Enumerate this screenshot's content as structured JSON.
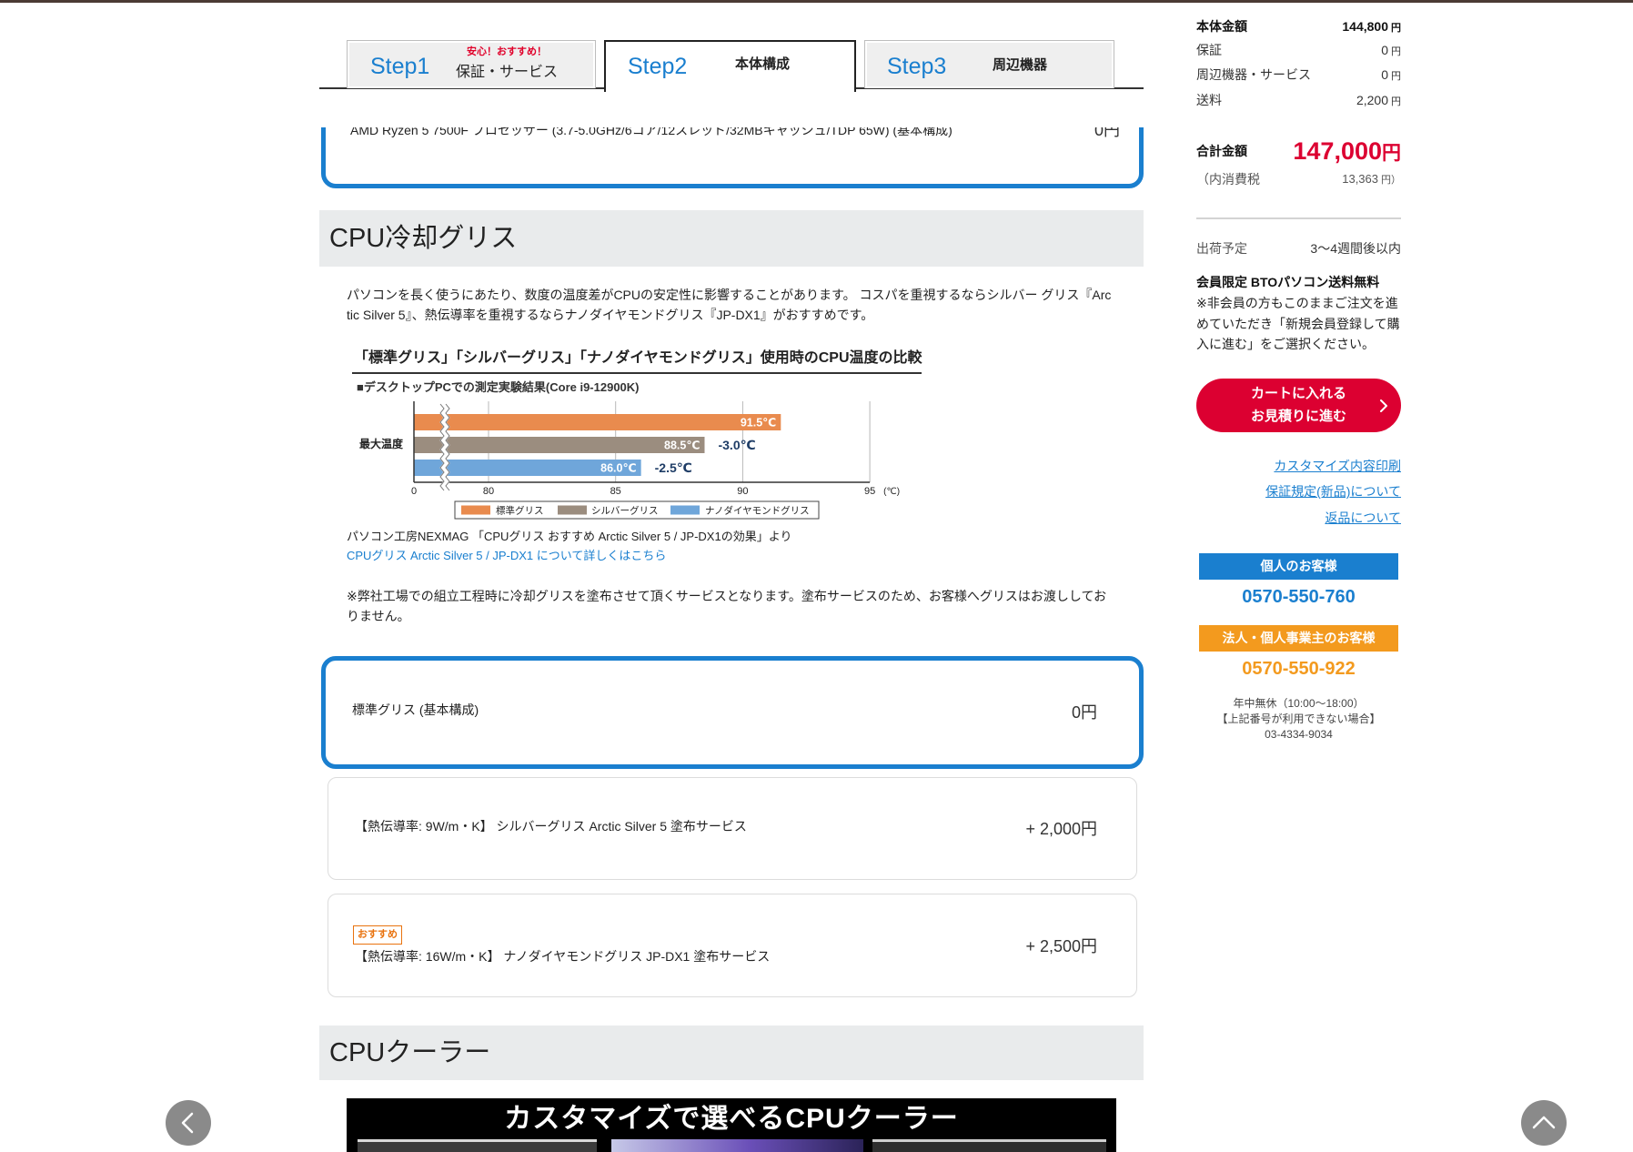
{
  "header": {
    "tabs": [
      {
        "step": "Step1",
        "badge": "安心！おすすめ！",
        "label": "保証・サービス",
        "active": false
      },
      {
        "step": "Step2",
        "label": "本体構成",
        "active": true
      },
      {
        "step": "Step3",
        "label": "周辺機器",
        "active": false
      }
    ]
  },
  "cpu_option": {
    "label": "AMD Ryzen 5 7500F プロセッサー (3.7-5.0GHz/6コア/12スレッド/32MBキャッシュ/TDP 65W) (基本構成)",
    "price": "0円",
    "selected": true
  },
  "grease_section": {
    "title": "CPU冷却グリス",
    "intro_lines": [
      "パソコンを長く使うにあたり、数度の温度差がCPUの安定性に影響することがあります。 コスパを重視するならシルバー グリス『Arc",
      "tic Silver 5』、熱伝導率を重視するならナノダイヤモンドグリス『JP-DX1』がおすすめです。"
    ],
    "source": "パソコン工房NEXMAG 「CPUグリス おすすめ Arctic Silver 5 / JP-DX1の効果」より",
    "link": "CPUグリス Arctic Silver 5 / JP-DX1 について詳しくはこちら",
    "note_lines": [
      "※弊社工場での組立工程時に冷却グリスを塗布させて頂くサービスとなります。塗布サービスのため、お客様へグリスはお渡ししてお",
      "りません。"
    ],
    "options": [
      {
        "label": "標準グリス (基本構成)",
        "price": "0円",
        "selected": true
      },
      {
        "label": "【熱伝導率: 9W/m・K】 シルバーグリス Arctic Silver 5 塗布サービス",
        "price": "+ 2,000円",
        "selected": false
      },
      {
        "badge": "おすすめ",
        "label": "【熱伝導率: 16W/m・K】 ナノダイヤモンドグリス JP-DX1 塗布サービス",
        "price": "+ 2,500円",
        "selected": false
      }
    ]
  },
  "cooler_section": {
    "title": "CPUクーラー",
    "banner_text": "カスタマイズで選べるCPUクーラー"
  },
  "chart_data": {
    "type": "bar",
    "orientation": "horizontal",
    "title": "「標準グリス」「シルバーグリス」「ナノダイヤモンドグリス」使用時のCPU温度の比較",
    "subtitle": "■デスクトップPCでの測定実験結果(Core i9-12900K)",
    "ylabel": "最大温度",
    "x_unit": "(℃)",
    "x_ticks": [
      "0",
      "80",
      "85",
      "90",
      "95"
    ],
    "x_tick_values": [
      0,
      80,
      85,
      90,
      95
    ],
    "xlim": [
      0,
      95
    ],
    "axis_break": [
      0,
      80
    ],
    "grid": true,
    "legend_position": "bottom",
    "series": [
      {
        "name": "標準グリス",
        "value": 91.5,
        "label": "91.5℃",
        "color": "#e98b4e"
      },
      {
        "name": "シルバーグリス",
        "value": 88.5,
        "label": "88.5℃",
        "diff": "-3.0℃",
        "color": "#9b8d7f"
      },
      {
        "name": "ナノダイヤモンドグリス",
        "value": 86.0,
        "label": "86.0℃",
        "diff": "-2.5℃",
        "color": "#6fa6da"
      }
    ]
  },
  "sidebar": {
    "summary": [
      {
        "label": "本体金額",
        "value": "144,800",
        "unit": "円"
      },
      {
        "label": "保証",
        "value": "0",
        "unit": "円"
      },
      {
        "label": "周辺機器・サービス",
        "value": "0",
        "unit": "円"
      },
      {
        "label": "送料",
        "value": "2,200",
        "unit": "円"
      }
    ],
    "total_label": "合計金額",
    "total_value": "147,000",
    "total_unit": "円",
    "tax_label": "（内消費税",
    "tax_value": "13,363",
    "tax_unit": "円）",
    "ship_label": "出荷予定",
    "ship_value": "3～4週間後以内",
    "member_title": "会員限定 BTOパソコン送料無料",
    "member_note_lines": [
      "※非会員の方もこのままご注文を進",
      "めていただき「新規会員登録して購",
      "入に進む」をご選択ください。"
    ],
    "cart_button": {
      "line1": "カートに入れる",
      "line2": "お見積りに進む",
      "icon": "chevron-right-icon"
    },
    "links": [
      "カスタマイズ内容印刷",
      "保証規定(新品)について",
      "返品について"
    ],
    "contact": {
      "personal": {
        "label": "個人のお客様",
        "phone": "0570-550-760"
      },
      "business": {
        "label": "法人・個人事業主のお客様",
        "phone": "0570-550-922"
      },
      "hours": "年中無休（10:00～18:00）",
      "alt_label": "【上記番号が利用できない場合】",
      "alt_phone": "03-4334-9034"
    }
  },
  "nav": {
    "prev_icon": "chevron-left-icon",
    "top_icon": "chevron-up-icon"
  },
  "colors": {
    "accent_blue": "#1a7fcf",
    "price_red": "#dc0031",
    "business_orange": "#f39a1e",
    "section_gray": "#e9ebec"
  }
}
